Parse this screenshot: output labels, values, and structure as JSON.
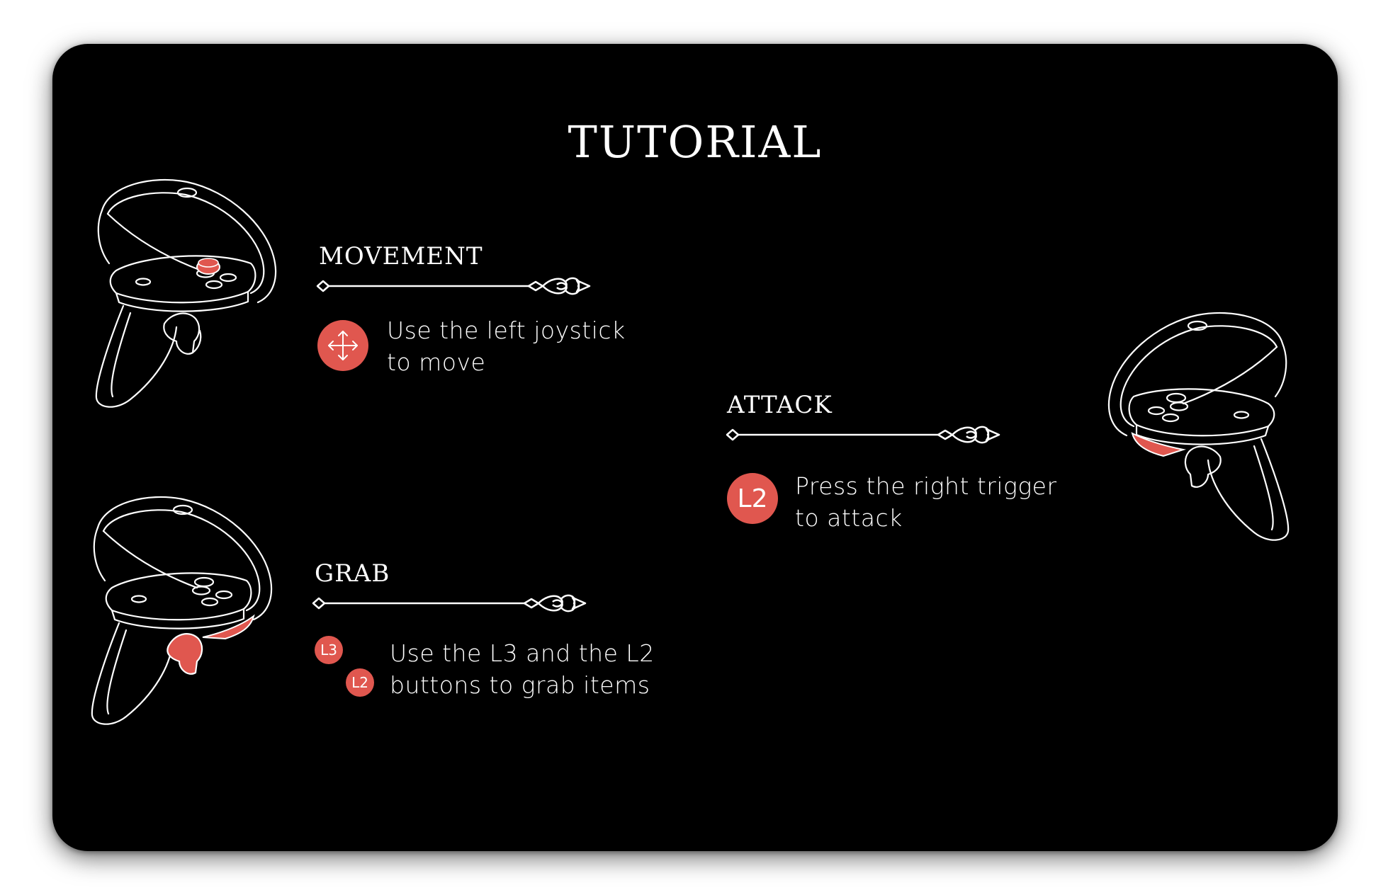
{
  "title": "TUTORIAL",
  "colors": {
    "accent": "#e0574f",
    "background": "#000000",
    "line": "#ffffff"
  },
  "sections": {
    "movement": {
      "heading": "MOVEMENT",
      "icon": "move-arrows-icon",
      "line1": "Use the left joystick",
      "line2": "to move"
    },
    "grab": {
      "heading": "GRAB",
      "badge1": "L3",
      "badge2": "L2",
      "line1": "Use the L3 and the L2",
      "line2": "buttons to grab items"
    },
    "attack": {
      "heading": "ATTACK",
      "badge": "L2",
      "line1": "Press the right trigger",
      "line2": "to attack"
    }
  }
}
